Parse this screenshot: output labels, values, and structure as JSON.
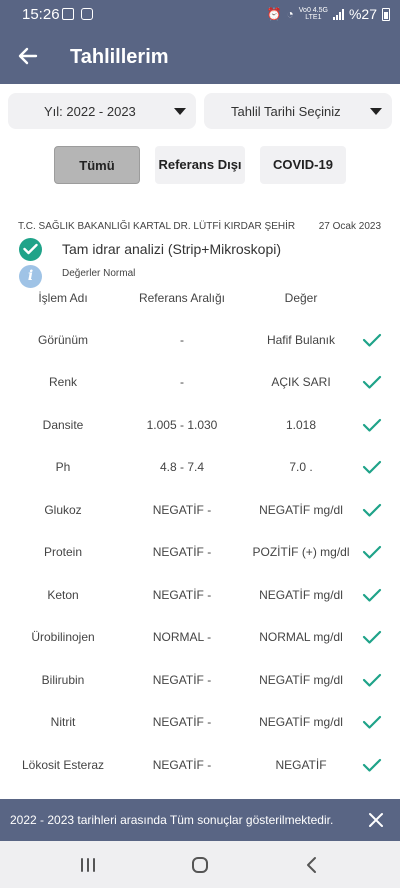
{
  "status_bar": {
    "time": "15:26",
    "network_top": "Vo0 4.5G",
    "network_bottom": "LTE1",
    "battery": "%27"
  },
  "app_bar": {
    "back_icon": "arrow-left-icon",
    "title": "Tahlillerim"
  },
  "filters": {
    "year_label": "Yıl: 2022 - 2023",
    "date_label": "Tahlil Tarihi Seçiniz",
    "chips": [
      "Tümü",
      "Referans Dışı",
      "COVID-19"
    ],
    "active_chip": "Tümü"
  },
  "result": {
    "hospital": "T.C. SAĞLIK BAKANLIĞI KARTAL DR. LÜTFİ KIRDAR ŞEHİR",
    "date": "27 Ocak 2023",
    "test_name": "Tam idrar analizi (Strip+Mikroskopi)",
    "status_note": "Değerler Normal"
  },
  "table": {
    "headers": [
      "İşlem Adı",
      "Referans Aralığı",
      "Değer"
    ],
    "rows": [
      {
        "name": "Görünüm",
        "ref": "-",
        "value": "Hafif Bulanık"
      },
      {
        "name": "Renk",
        "ref": "-",
        "value": "AÇIK SARI"
      },
      {
        "name": "Dansite",
        "ref": "1.005 - 1.030",
        "value": "1.018"
      },
      {
        "name": "Ph",
        "ref": "4.8 - 7.4",
        "value": "7.0 ."
      },
      {
        "name": "Glukoz",
        "ref": "NEGATİF -",
        "value": "NEGATİF mg/dl"
      },
      {
        "name": "Protein",
        "ref": "NEGATİF -",
        "value": "POZİTİF (+) mg/dl"
      },
      {
        "name": "Keton",
        "ref": "NEGATİF -",
        "value": "NEGATİF mg/dl"
      },
      {
        "name": "Ürobilinojen",
        "ref": "NORMAL -",
        "value": "NORMAL mg/dl"
      },
      {
        "name": "Bilirubin",
        "ref": "NEGATİF -",
        "value": "NEGATİF mg/dl"
      },
      {
        "name": "Nitrit",
        "ref": "NEGATİF -",
        "value": "NEGATİF mg/dl"
      },
      {
        "name": "Lökosit Esteraz",
        "ref": "NEGATİF -",
        "value": "NEGATİF"
      }
    ]
  },
  "snackbar": {
    "message": "2022 - 2023 tarihleri arasında Tüm sonuçlar gösterilmektedir.",
    "close_icon": "close-icon"
  },
  "colors": {
    "primary": "#596584",
    "check_green": "#1fa389",
    "info_blue": "#9fc3e6",
    "chip_active": "#b5b5b5"
  }
}
